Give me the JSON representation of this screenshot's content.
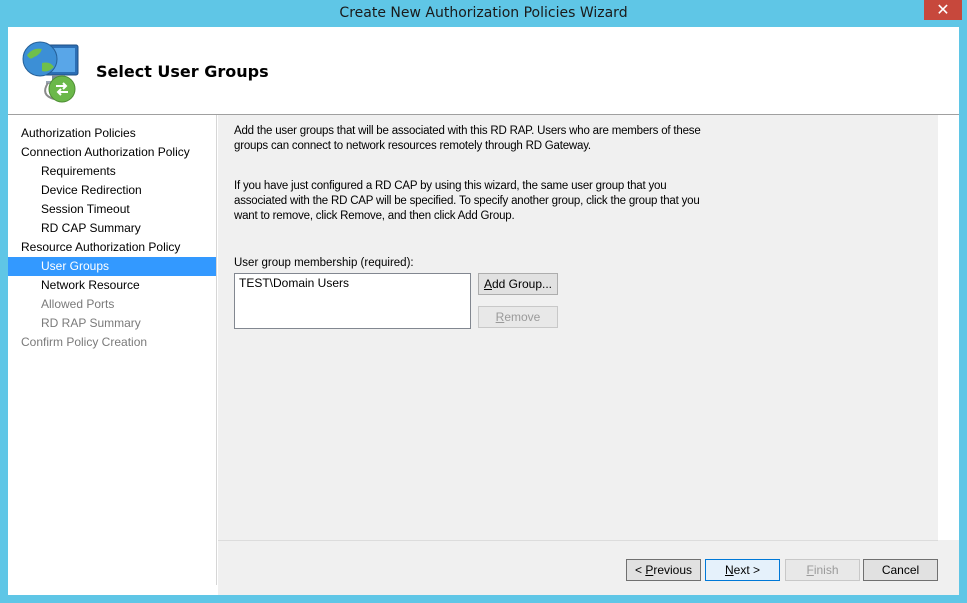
{
  "window": {
    "title": "Create New Authorization Policies Wizard",
    "close_glyph": "✕"
  },
  "header": {
    "title": "Select User Groups",
    "icon": "remote-desktop-gateway-icon"
  },
  "nav": {
    "items": [
      {
        "label": "Authorization Policies",
        "level": 0,
        "state": "normal"
      },
      {
        "label": "Connection Authorization Policy",
        "level": 0,
        "state": "normal"
      },
      {
        "label": "Requirements",
        "level": 1,
        "state": "normal"
      },
      {
        "label": "Device Redirection",
        "level": 1,
        "state": "normal"
      },
      {
        "label": "Session Timeout",
        "level": 1,
        "state": "normal"
      },
      {
        "label": "RD CAP Summary",
        "level": 1,
        "state": "normal"
      },
      {
        "label": "Resource Authorization Policy",
        "level": 0,
        "state": "normal"
      },
      {
        "label": "User Groups",
        "level": 1,
        "state": "selected"
      },
      {
        "label": "Network Resource",
        "level": 1,
        "state": "normal"
      },
      {
        "label": "Allowed Ports",
        "level": 1,
        "state": "disabled"
      },
      {
        "label": "RD RAP Summary",
        "level": 1,
        "state": "disabled"
      },
      {
        "label": "Confirm Policy Creation",
        "level": 0,
        "state": "disabled"
      }
    ]
  },
  "content": {
    "para1": "Add the user groups that will be associated with this RD RAP. Users who are members of these groups can connect to network resources remotely through RD Gateway.",
    "para2": "If you have just configured a RD CAP by using this wizard, the same user group that you associated with the RD CAP will be specified. To specify another group, click the group that you want to remove, click Remove, and then click Add Group.",
    "group_label": "User group membership (required):",
    "groups": [
      "TEST\\Domain Users"
    ],
    "add_group": {
      "mnemonic": "A",
      "rest": "dd Group..."
    },
    "remove": {
      "mnemonic": "R",
      "rest": "emove"
    }
  },
  "footer": {
    "previous": {
      "prefix": "< ",
      "mnemonic": "P",
      "rest": "revious"
    },
    "next": {
      "mnemonic": "N",
      "rest": "ext >"
    },
    "finish": {
      "mnemonic": "F",
      "rest": "inish"
    },
    "cancel": "Cancel"
  },
  "colors": {
    "chrome": "#5fc6e6",
    "selection": "#3399ff",
    "close": "#c7483c",
    "panel": "#f0f0f0"
  }
}
